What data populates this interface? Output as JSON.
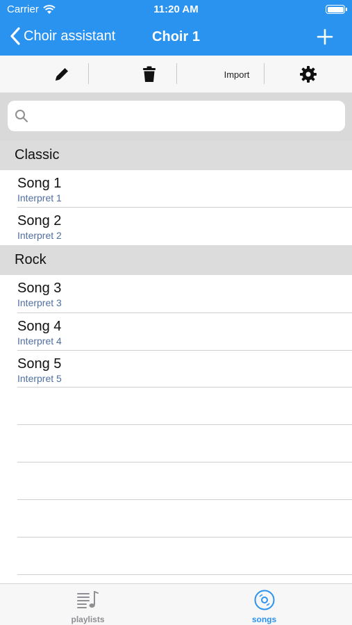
{
  "status_bar": {
    "carrier": "Carrier",
    "time": "11:20 AM"
  },
  "nav": {
    "back_label": "Choir assistant",
    "title": "Choir 1",
    "add_icon": "plus-icon"
  },
  "toolbar": {
    "edit_icon": "pencil-icon",
    "delete_icon": "trash-icon",
    "import_label": "Import",
    "settings_icon": "gear-icon"
  },
  "search": {
    "value": "",
    "placeholder": ""
  },
  "sections": [
    {
      "header": "Classic",
      "songs": [
        {
          "title": "Song 1",
          "interpret": "Interpret 1"
        },
        {
          "title": "Song 2",
          "interpret": "Interpret 2"
        }
      ]
    },
    {
      "header": "Rock",
      "songs": [
        {
          "title": "Song 3",
          "interpret": "Interpret 3"
        },
        {
          "title": "Song 4",
          "interpret": "Interpret 4"
        },
        {
          "title": "Song 5",
          "interpret": "Interpret 5"
        }
      ]
    }
  ],
  "tabbar": {
    "tabs": [
      {
        "label": "playlists",
        "icon": "playlist-icon",
        "active": false
      },
      {
        "label": "songs",
        "icon": "disc-icon",
        "active": true
      }
    ]
  },
  "colors": {
    "accent": "#2a93f0",
    "subtitle": "#4f6fa0",
    "inactive_tab": "#8e8e93"
  }
}
